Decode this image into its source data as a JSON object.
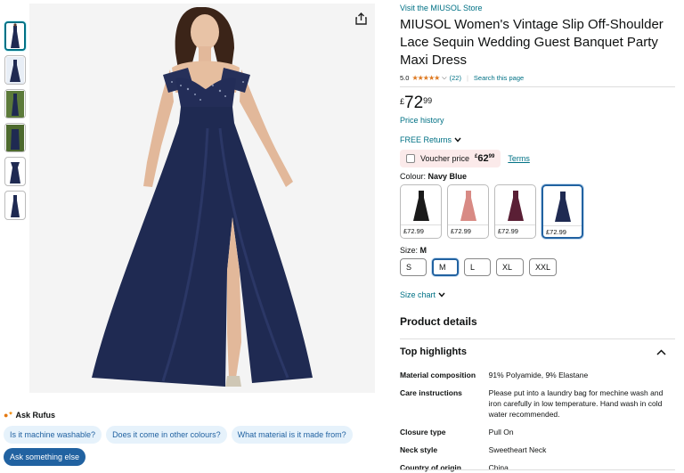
{
  "store_link": "Visit the MIUSOL Store",
  "product_title": "MIUSOL Women's Vintage Slip Off-Shoulder Lace Sequin Wedding Guest Banquet Party Maxi Dress",
  "rating": {
    "value": "5.0",
    "stars": "★★★★★",
    "count": "(22)",
    "search_link": "Search this page"
  },
  "price": {
    "currency": "£",
    "whole": "72",
    "fraction": "99"
  },
  "price_history": "Price history",
  "free_returns": "FREE Returns",
  "voucher": {
    "label": "Voucher price",
    "currency": "£",
    "whole": "62",
    "fraction": "99",
    "terms": "Terms"
  },
  "colour": {
    "label": "Colour:",
    "selected": "Navy Blue",
    "options": [
      {
        "price": "£72.99",
        "color": "#1a1a1a"
      },
      {
        "price": "£72.99",
        "color": "#d88a84"
      },
      {
        "price": "£72.99",
        "color": "#5a1f35"
      },
      {
        "price": "£72.99",
        "color": "#1f2a52"
      }
    ]
  },
  "size": {
    "label": "Size:",
    "selected": "M",
    "options": [
      "S",
      "M",
      "L",
      "XL",
      "XXL"
    ]
  },
  "size_chart": "Size chart",
  "product_details_title": "Product details",
  "top_highlights_title": "Top highlights",
  "details": [
    {
      "key": "Material composition",
      "value": "91% Polyamide, 9% Elastane"
    },
    {
      "key": "Care instructions",
      "value": "Please put into a laundry bag for mechine wash and iron carefully in low temperature. Hand wash in cold water recommended."
    },
    {
      "key": "Closure type",
      "value": "Pull On"
    },
    {
      "key": "Neck style",
      "value": "Sweetheart Neck"
    },
    {
      "key": "Country of origin",
      "value": "China"
    }
  ],
  "rufus": {
    "title": "Ask Rufus",
    "chips": [
      "Is it machine washable?",
      "Does it come in other colours?",
      "What material is it made from?"
    ],
    "ask_more": "Ask something else"
  },
  "colors": {
    "link": "#007185",
    "accent": "#2162a1",
    "star": "#de7921",
    "dress": "#1f2a52"
  }
}
